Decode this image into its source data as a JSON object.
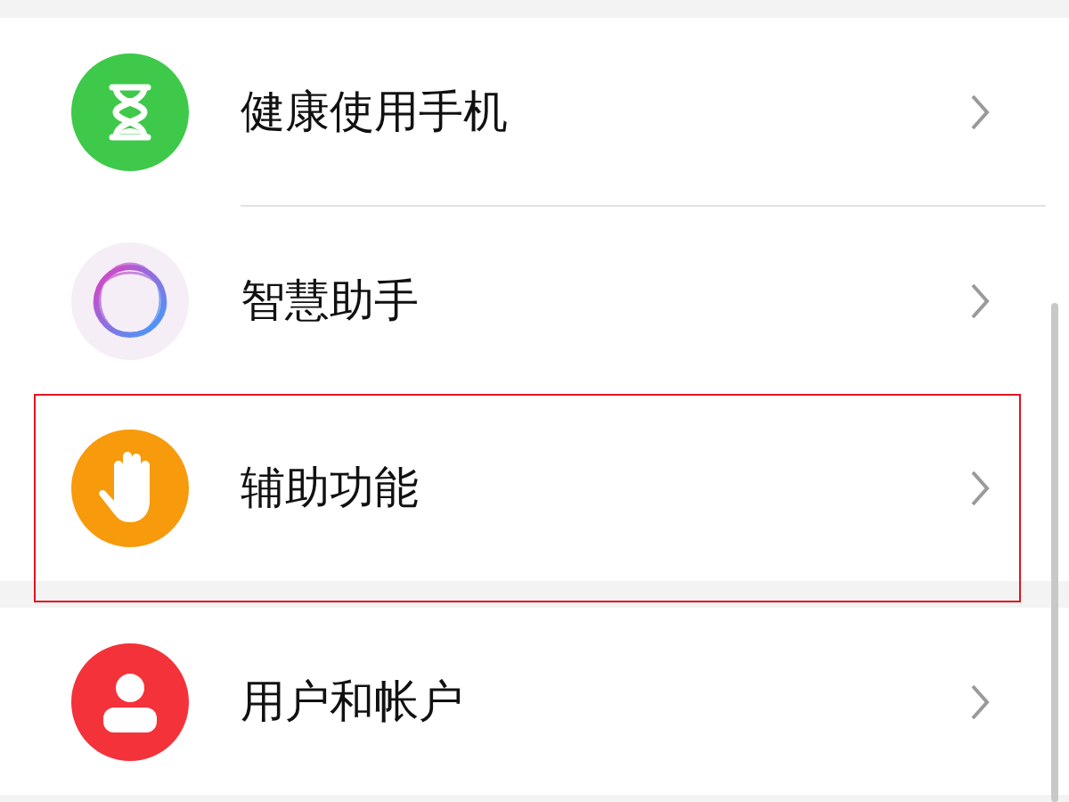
{
  "groups": [
    {
      "items": [
        {
          "label": "健康使用手机",
          "kind": "hourglass",
          "highlighted": false
        },
        {
          "label": "智慧助手",
          "kind": "ring",
          "highlighted": false
        },
        {
          "label": "辅助功能",
          "kind": "hand",
          "highlighted": true
        }
      ]
    },
    {
      "items": [
        {
          "label": "用户和帐户",
          "kind": "person",
          "highlighted": false
        }
      ]
    }
  ]
}
